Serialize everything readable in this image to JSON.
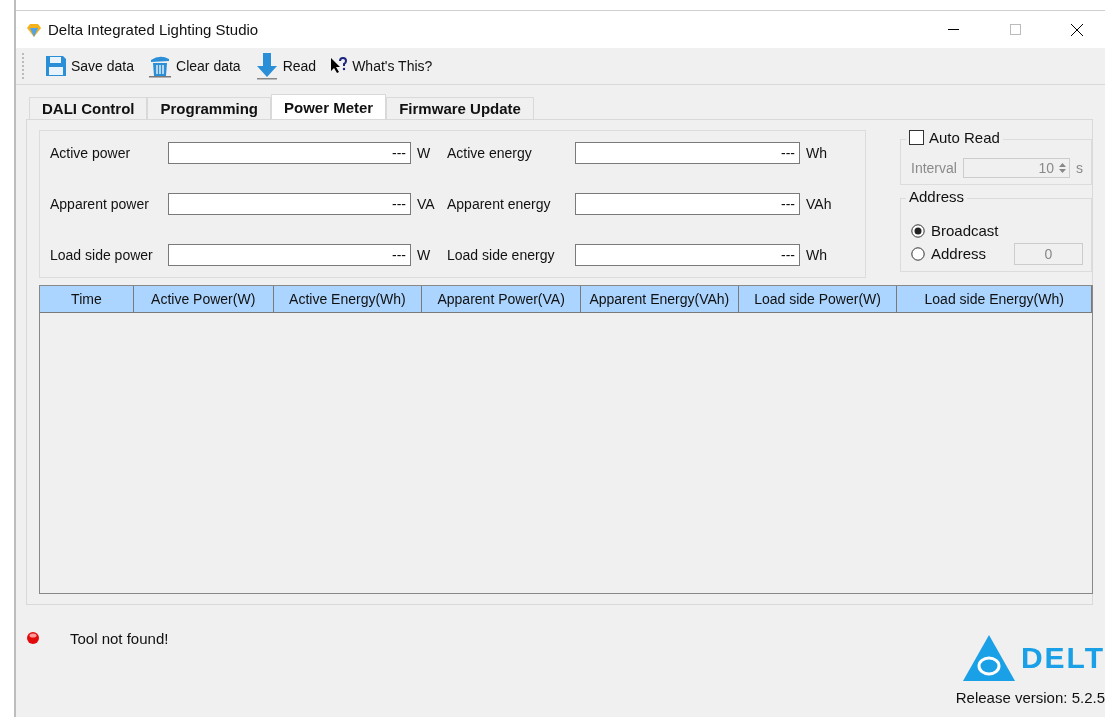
{
  "window": {
    "title": "Delta Integrated Lighting Studio"
  },
  "toolbar": [
    {
      "label": "Save data",
      "kind": "save"
    },
    {
      "label": "Clear data",
      "kind": "clear"
    },
    {
      "label": "Read",
      "kind": "read"
    },
    {
      "label": "What's This?",
      "kind": "help"
    }
  ],
  "tabs": [
    {
      "label": "DALI Control",
      "selected": false
    },
    {
      "label": "Programming",
      "selected": false
    },
    {
      "label": "Power Meter",
      "selected": true
    },
    {
      "label": "Firmware Update",
      "selected": false
    }
  ],
  "fields": [
    {
      "label": "Active power",
      "value": "---",
      "unit": "W"
    },
    {
      "label": "Active energy",
      "value": "---",
      "unit": "Wh"
    },
    {
      "label": "Apparent power",
      "value": "---",
      "unit": "VA"
    },
    {
      "label": "Apparent energy",
      "value": "---",
      "unit": "VAh"
    },
    {
      "label": "Load side power",
      "value": "---",
      "unit": "W"
    },
    {
      "label": "Load side energy",
      "value": "---",
      "unit": "Wh"
    }
  ],
  "auto_read": {
    "label": "Auto Read",
    "checked": false,
    "interval_label": "Interval",
    "interval": "10",
    "unit": "s",
    "disabled": true
  },
  "address": {
    "title": "Address",
    "options": [
      {
        "label": "Broadcast",
        "selected": true
      },
      {
        "label": "Address",
        "selected": false
      }
    ],
    "value": "0"
  },
  "table": {
    "columns": [
      "Time",
      "Active Power(W)",
      "Active Energy(Wh)",
      "Apparent Power(VA)",
      "Apparent Energy(VAh)",
      "Load side Power(W)",
      "Load side Energy(Wh)"
    ]
  },
  "status": {
    "message": "Tool not found!",
    "connected": false
  },
  "footer": {
    "logo_text": "DELT",
    "release": "Release version: 5.2.5"
  }
}
